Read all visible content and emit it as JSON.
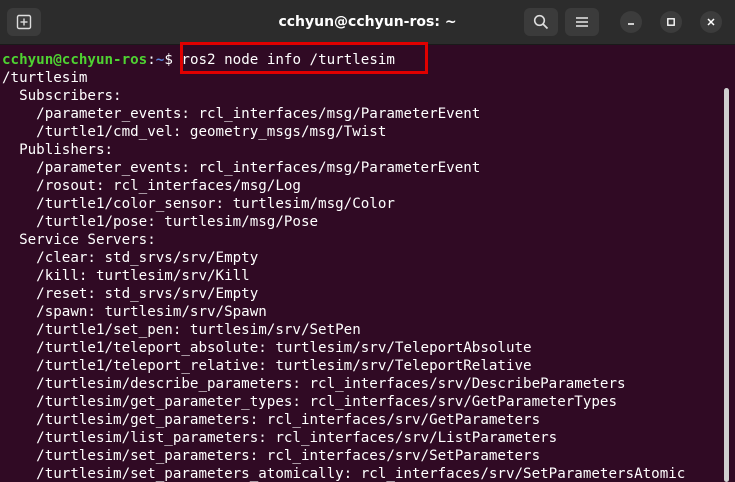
{
  "window": {
    "title": "cchyun@cchyun-ros: ~",
    "icons": {
      "new_tab": "new-tab-icon",
      "search": "search-icon",
      "menu": "hamburger-menu-icon",
      "minimize": "minimize-icon",
      "maximize": "maximize-icon",
      "close": "close-icon"
    }
  },
  "terminal": {
    "prompt": {
      "user_host": "cchyun@cchyun-ros",
      "colon": ":",
      "path": "~",
      "symbol": "$ ",
      "command": "ros2 node info /turtlesim"
    },
    "output": [
      "/turtlesim",
      "  Subscribers:",
      "    /parameter_events: rcl_interfaces/msg/ParameterEvent",
      "    /turtle1/cmd_vel: geometry_msgs/msg/Twist",
      "  Publishers:",
      "    /parameter_events: rcl_interfaces/msg/ParameterEvent",
      "    /rosout: rcl_interfaces/msg/Log",
      "    /turtle1/color_sensor: turtlesim/msg/Color",
      "    /turtle1/pose: turtlesim/msg/Pose",
      "  Service Servers:",
      "    /clear: std_srvs/srv/Empty",
      "    /kill: turtlesim/srv/Kill",
      "    /reset: std_srvs/srv/Empty",
      "    /spawn: turtlesim/srv/Spawn",
      "    /turtle1/set_pen: turtlesim/srv/SetPen",
      "    /turtle1/teleport_absolute: turtlesim/srv/TeleportAbsolute",
      "    /turtle1/teleport_relative: turtlesim/srv/TeleportRelative",
      "    /turtlesim/describe_parameters: rcl_interfaces/srv/DescribeParameters",
      "    /turtlesim/get_parameter_types: rcl_interfaces/srv/GetParameterTypes",
      "    /turtlesim/get_parameters: rcl_interfaces/srv/GetParameters",
      "    /turtlesim/list_parameters: rcl_interfaces/srv/ListParameters",
      "    /turtlesim/set_parameters: rcl_interfaces/srv/SetParameters",
      "    /turtlesim/set_parameters_atomically: rcl_interfaces/srv/SetParametersAtomic"
    ]
  },
  "colors": {
    "terminal_bg": "#300a24",
    "prompt_user": "#4fd232",
    "prompt_path": "#5a83d8",
    "highlight_box": "#e00000",
    "titlebar_bg": "#2c2c2c"
  }
}
